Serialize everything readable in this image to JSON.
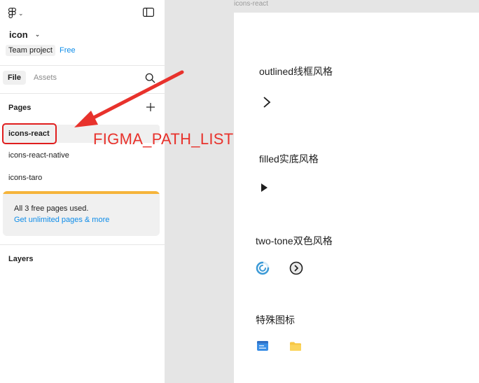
{
  "file": {
    "name": "icon",
    "team_label": "Team project",
    "plan_badge": "Free"
  },
  "tabs": [
    {
      "label": "File",
      "active": true
    },
    {
      "label": "Assets",
      "active": false
    }
  ],
  "pages": {
    "heading": "Pages",
    "items": [
      {
        "name": "icons-react",
        "selected": true
      },
      {
        "name": "icons-react-native",
        "selected": false
      },
      {
        "name": "icons-taro",
        "selected": false
      }
    ]
  },
  "banner": {
    "message": "All 3 free pages used.",
    "link": "Get unlimited pages & more",
    "accent": "#f5b43a"
  },
  "layers": {
    "heading": "Layers"
  },
  "annotation": {
    "label": "FIGMA_PATH_LIST",
    "color": "#e8322c"
  },
  "canvas": {
    "frame_name": "icons-react",
    "sections": [
      {
        "title": "outlined线框风格",
        "icons": [
          "chevron-right-outlined-icon"
        ]
      },
      {
        "title": "filled实底风格",
        "icons": [
          "caret-right-filled-icon"
        ]
      },
      {
        "title": "two-tone双色风格",
        "icons": [
          "loading-two-tone-icon",
          "right-circle-two-tone-icon"
        ]
      },
      {
        "title": "特殊图标",
        "icons": [
          "id-card-special-icon",
          "folder-special-icon"
        ]
      }
    ]
  },
  "colors": {
    "accent_blue": "#0d8ce9",
    "highlight_red": "#e01e1e",
    "folder_yellow": "#f7c744"
  }
}
